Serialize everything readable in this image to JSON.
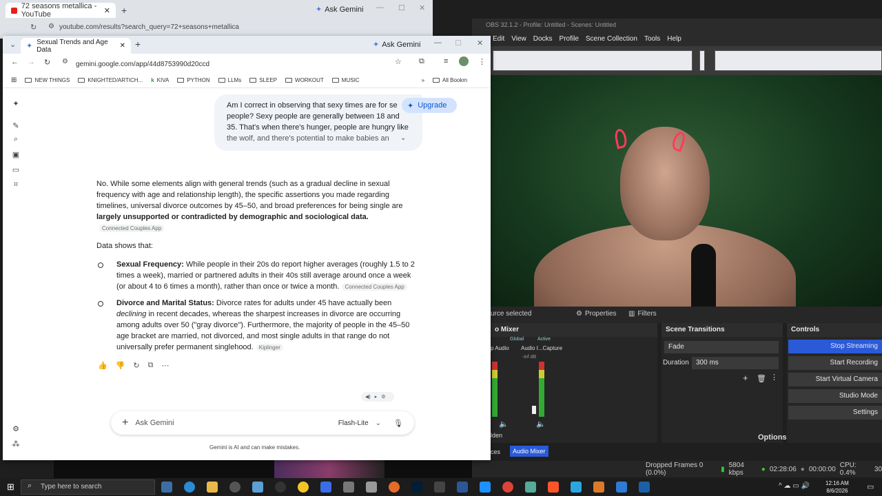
{
  "back_window": {
    "tab_title": "72 seasons metallica - YouTube",
    "url": "youtube.com/results?search_query=72+seasons+metallica",
    "ask": "Ask Gemini"
  },
  "obs": {
    "title": "OBS 32.1.2 - Profile: Untitled - Scenes: Untitled",
    "menu": [
      "Edit",
      "View",
      "Docks",
      "Profile",
      "Scene Collection",
      "Tools",
      "Help"
    ],
    "no_source": "urce selected",
    "properties": "Properties",
    "filters": "Filters",
    "mixer_title": "o Mixer",
    "mixer_global": "Global",
    "mixer_active": "Active",
    "mixer_ch1": "p Audio",
    "mixer_ch2": "Audio I...Capture",
    "mixer_inf": "-inf dB",
    "transitions_title": "Scene Transitions",
    "transition": "Fade",
    "duration_label": "Duration",
    "duration": "300 ms",
    "options": "Options",
    "controls_title": "Controls",
    "controls": [
      "Stop Streaming",
      "Start Recording",
      "Start Virtual Camera",
      "Studio Mode",
      "Settings"
    ],
    "tab_sources": "ces",
    "tab_mixer": "Audio Mixer",
    "tab_hidden": "lden",
    "status": {
      "dropped": "Dropped Frames 0 (0.0%)",
      "kbps": "5804 kbps",
      "stream_time": "02:28:06",
      "rec_time": "00:00:00",
      "cpu": "CPU: 0.4%",
      "fps": "30"
    }
  },
  "gemini": {
    "tab_title": "Sexual Trends and Age Data",
    "ask_top": "Ask Gemini",
    "url": "gemini.google.com/app/44d8753990d20ccd",
    "bookmarks": [
      "NEW THINGS",
      "KNIGHTED/ARTICH...",
      "KIVA",
      "PYTHON",
      "LLMs",
      "SLEEP",
      "WORKOUT",
      "MUSIC"
    ],
    "all_bookmarks": "All Bookm",
    "upgrade": "Upgrade",
    "prompt": "Am I correct in observing that sexy times are for se... people? Sexy people are generally between 18 and 35. That's when there's hunger, people are hungry like the wolf, and there's potential to make babies an...",
    "prompt_lines": [
      "Am I correct in observing that sexy times are for se",
      "people? Sexy people are generally between 18 and",
      "35. That's when there's hunger, people are hungry like",
      "the wolf, and there's potential to make babies an"
    ],
    "answer_intro_1": "No. While some elements align with general trends (such as a gradual decline in sexual",
    "answer_intro_2": "frequency with age and relationship length), the specific assertions you made regarding",
    "answer_intro_3": "timelines, universal divorce outcomes by 45–50, and broad preferences for being single are",
    "answer_intro_bold": "largely unsupported or contradicted by demographic and sociological data",
    "source1": "Connected Couples App",
    "data_shows": "Data shows that:",
    "bullet1_label": "Sexual Frequency:",
    "bullet1_l1": "While people in their 20s do report higher averages (roughly 1.5 to 2",
    "bullet1_l2": "times a week), married or partnered adults in their 40s still average around once a week",
    "bullet1_l3": "(or about 4 to 6 times a month), rather than once or twice a month.",
    "bullet2_label": "Divorce and Marital Status:",
    "bullet2_l1a": "Divorce rates for adults under 45 have actually been",
    "bullet2_l2_em": "declining",
    "bullet2_l2": "in recent decades, whereas the sharpest increases in divorce are occurring",
    "bullet2_l3": "among adults over 50 (\"gray divorce\"). Furthermore, the majority of people in the 45–50",
    "bullet2_l4": "age bracket are married, not divorced, and most single adults in that range do not",
    "bullet2_l5": "universally prefer permanent singlehood.",
    "source2": "Kiplinger",
    "ask_placeholder": "Ask Gemini",
    "model": "Flash-Lite",
    "disclaimer": "Gemini is AI and can make mistakes."
  },
  "taskbar": {
    "search": "Type here to search",
    "time": "12:16 AM",
    "date": "8/6/2026"
  },
  "colors": {
    "accent_blue": "#0b57d0",
    "obs_stream": "#2a5ad7",
    "webcam_bg": "#1f4a27"
  }
}
